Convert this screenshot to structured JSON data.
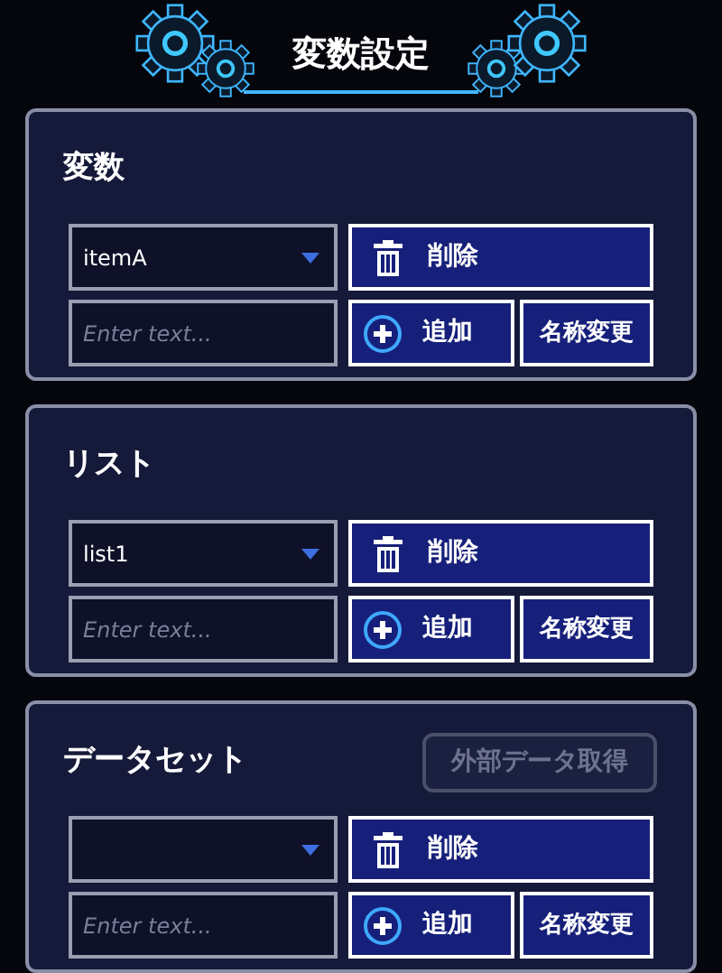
{
  "title": "変数設定",
  "sections": [
    {
      "heading": "変数",
      "dropdown": {
        "value": "itemA"
      },
      "input": {
        "placeholder": "Enter text..."
      },
      "delete_button": "削除",
      "add_button": "追加",
      "rename_button": "名称変更"
    },
    {
      "heading": "リスト",
      "dropdown": {
        "value": "list1"
      },
      "input": {
        "placeholder": "Enter text..."
      },
      "delete_button": "削除",
      "add_button": "追加",
      "rename_button": "名称変更"
    },
    {
      "heading": "データセット",
      "extra_button": {
        "label": "外部データ取得",
        "disabled": true
      },
      "input": {
        "placeholder": "Enter text..."
      },
      "delete_button": "削除",
      "add_button": "追加",
      "rename_button": "名称変更"
    }
  ]
}
